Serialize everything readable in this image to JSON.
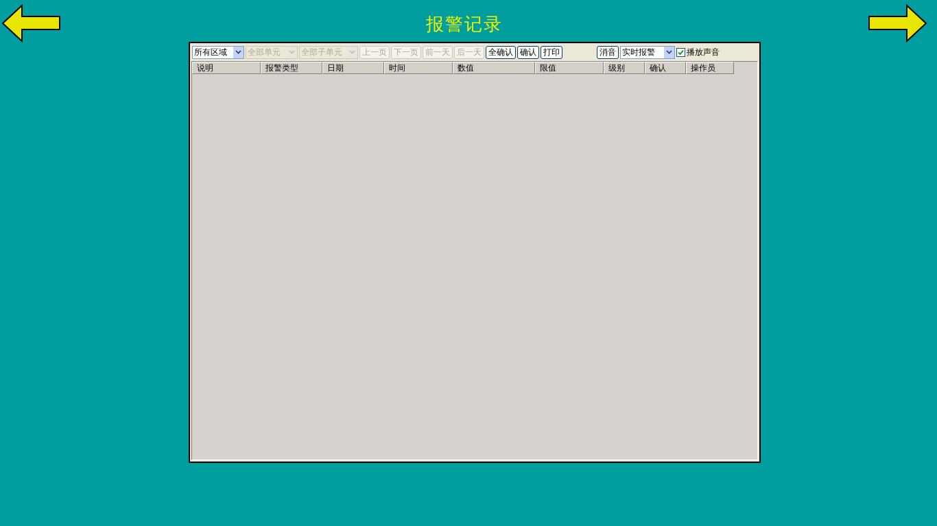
{
  "title": "报警记录",
  "toolbar": [
    {
      "kind": "select",
      "value": "所有区域",
      "disabled": false
    },
    {
      "kind": "select",
      "value": "全部单元",
      "disabled": true
    },
    {
      "kind": "select",
      "value": "全部子单元",
      "disabled": true
    },
    {
      "kind": "button",
      "label": "上一页",
      "disabled": true
    },
    {
      "kind": "button",
      "label": "下一页",
      "disabled": true
    },
    {
      "kind": "button",
      "label": "前一天",
      "disabled": true
    },
    {
      "kind": "button",
      "label": "后一天",
      "disabled": true
    },
    {
      "kind": "button",
      "label": "全确认",
      "disabled": false
    },
    {
      "kind": "button",
      "label": "确认",
      "disabled": false
    },
    {
      "kind": "button",
      "label": "打印",
      "disabled": false
    },
    {
      "kind": "spacer"
    },
    {
      "kind": "button",
      "label": "消音",
      "disabled": false
    },
    {
      "kind": "select",
      "value": "实时报警",
      "disabled": false
    },
    {
      "kind": "checkbox",
      "label": "播放声音",
      "checked": true
    }
  ],
  "table": {
    "columns": [
      "说明",
      "报警类型",
      "日期",
      "时间",
      "数值",
      "限值",
      "级别",
      "确认",
      "操作员"
    ]
  }
}
